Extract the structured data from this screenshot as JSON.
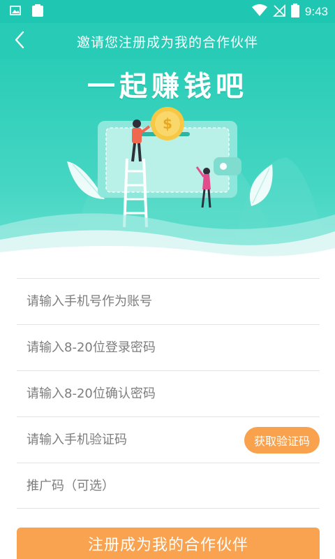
{
  "status_bar": {
    "time": "9:43",
    "icons": [
      "image-icon",
      "clipboard-icon",
      "wifi-icon",
      "no-signal-icon",
      "battery-icon"
    ]
  },
  "app_bar": {
    "title": "邀请您注册成为我的合作伙伴",
    "back_icon": "chevron-left-icon"
  },
  "hero": {
    "heading": "一起赚钱吧",
    "coin_symbol": "$"
  },
  "form": {
    "phone": {
      "placeholder": "请输入手机号作为账号",
      "value": ""
    },
    "password": {
      "placeholder": "请输入8-20位登录密码",
      "value": ""
    },
    "confirm_password": {
      "placeholder": "请输入8-20位确认密码",
      "value": ""
    },
    "sms_code": {
      "placeholder": "请输入手机验证码",
      "value": "",
      "button_label": "获取验证码"
    },
    "referral": {
      "placeholder": "推广码（可选）",
      "value": ""
    }
  },
  "submit_label": "注册成为我的合作伙伴",
  "colors": {
    "primary": "#28ccb6",
    "status_bar": "#1fc7b2",
    "accent": "#f9a24f"
  }
}
